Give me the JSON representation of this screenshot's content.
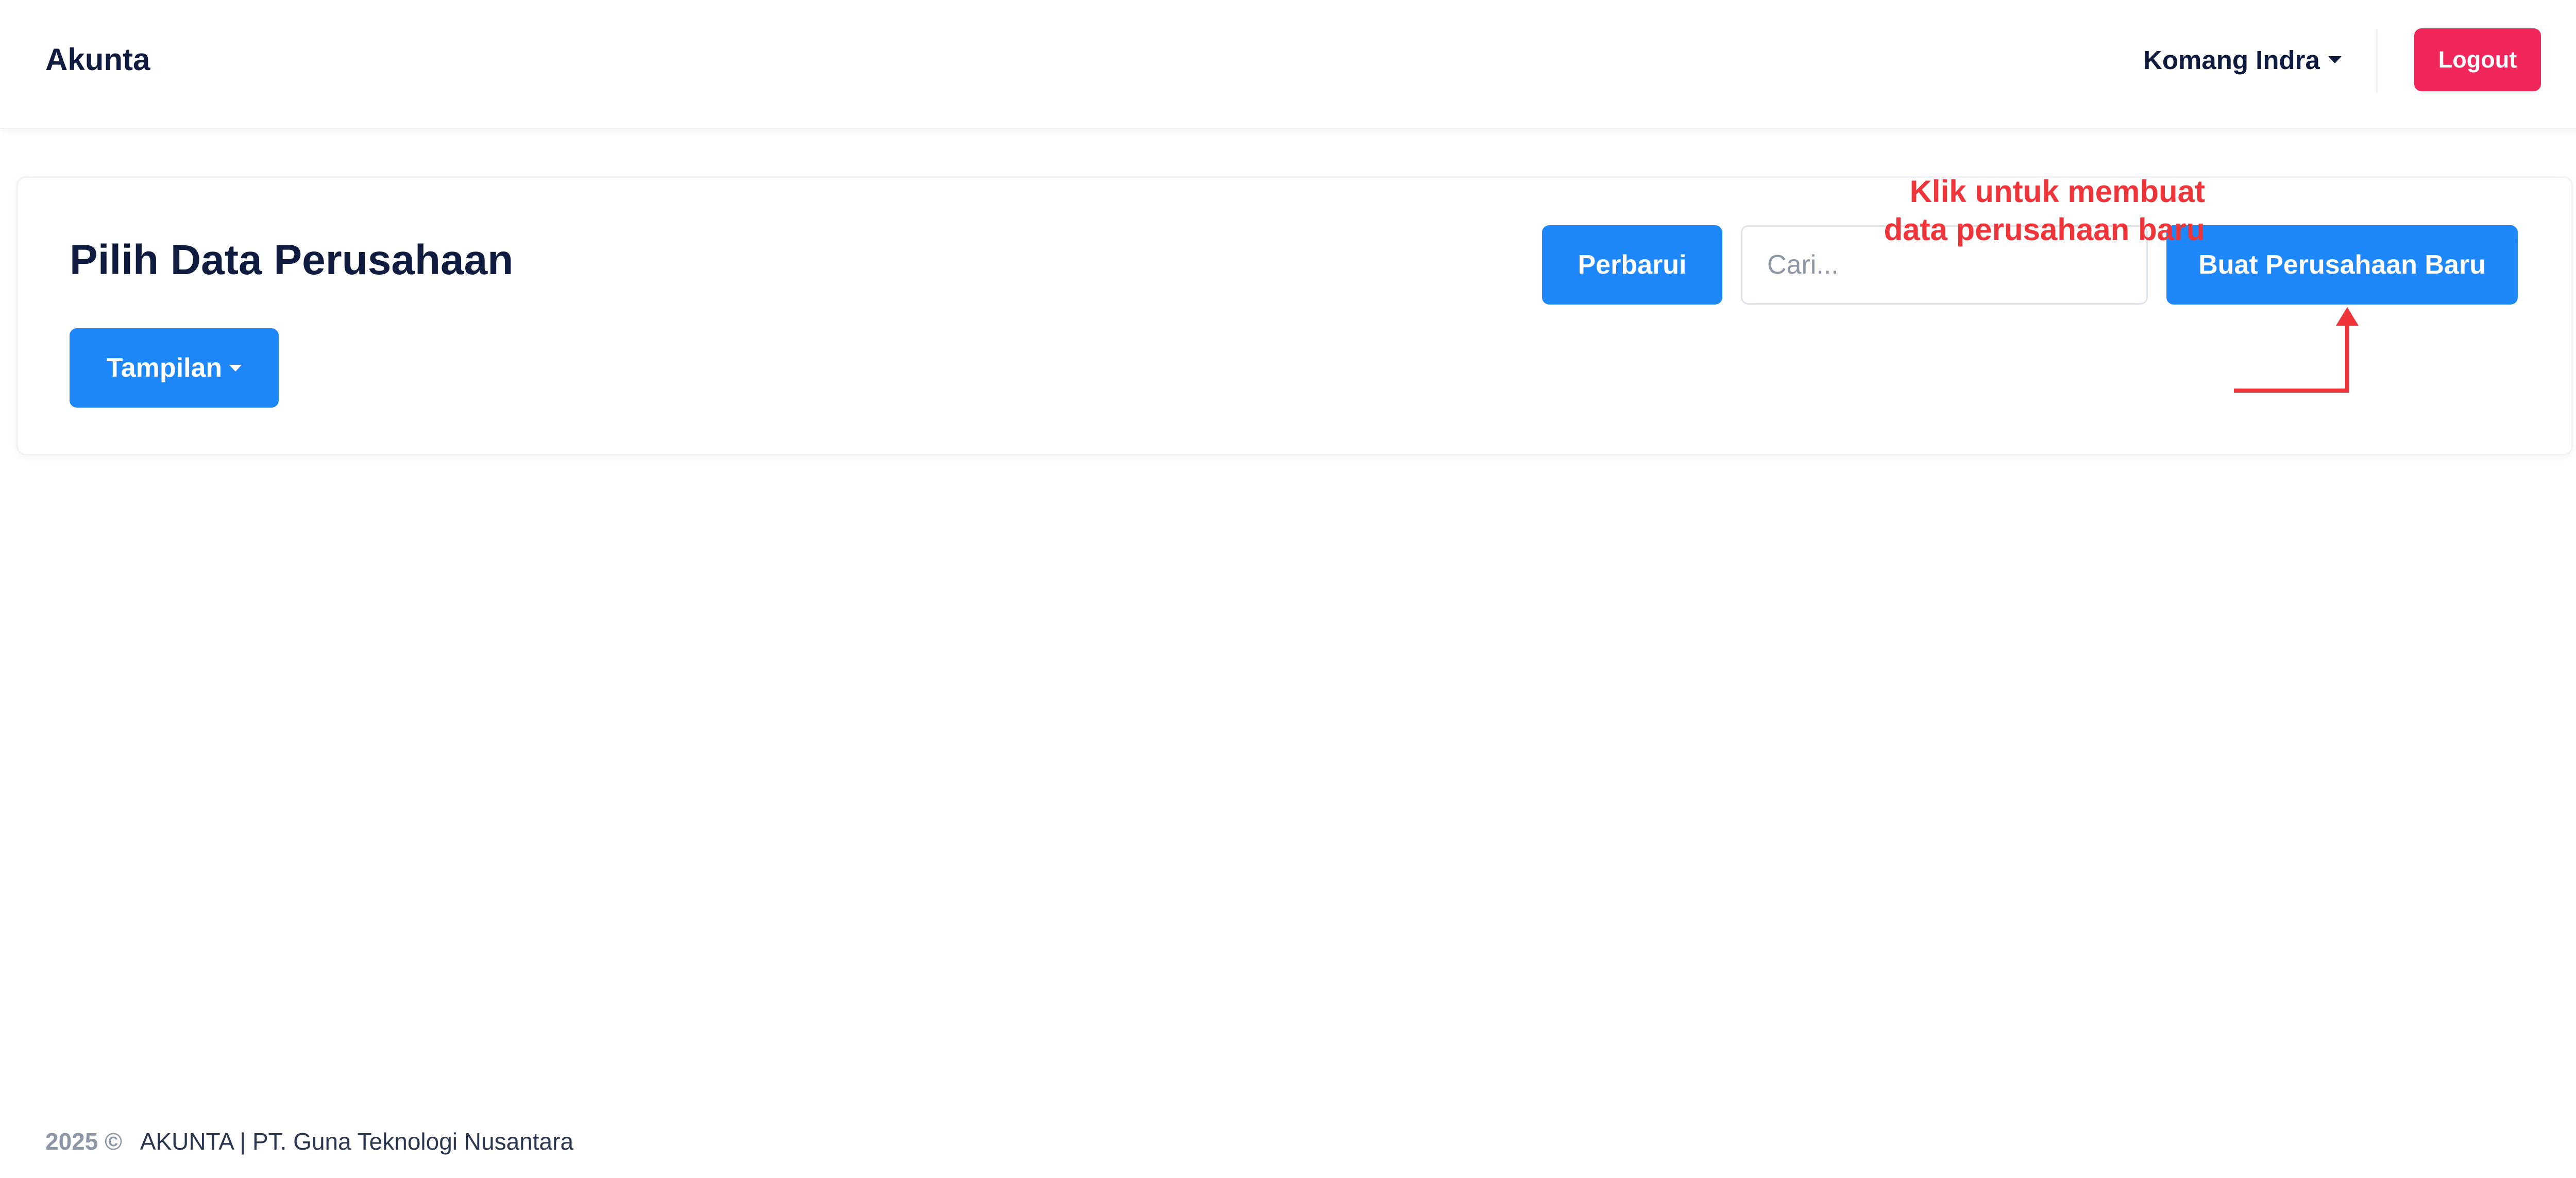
{
  "navbar": {
    "brand": "Akunta",
    "user_name": "Komang Indra",
    "logout_label": "Logout"
  },
  "card": {
    "title": "Pilih Data Perusahaan",
    "refresh_label": "Perbarui",
    "search_placeholder": "Cari...",
    "search_value": "",
    "new_company_label": "Buat Perusahaan Baru",
    "view_label": "Tampilan"
  },
  "annotation": {
    "line1": "Klik untuk membuat",
    "line2": "data perusahaan baru",
    "color": "#f0353a"
  },
  "footer": {
    "year": "2025 ©",
    "text": "AKUNTA | PT. Guna Teknologi Nusantara"
  },
  "colors": {
    "primary": "#1e88fa",
    "danger": "#f1265a",
    "text": "#0f1c3f"
  },
  "icons": {
    "user_caret": "chevron-down-icon",
    "view_caret": "chevron-down-icon",
    "annotation_arrow": "arrow-up-icon"
  }
}
